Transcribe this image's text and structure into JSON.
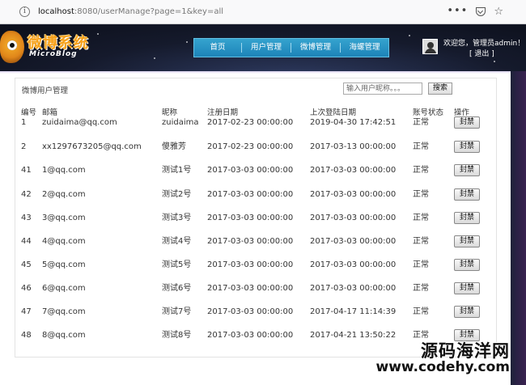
{
  "browser": {
    "url_host": "localhost",
    "url_rest": ":8080/userManage?page=1&key=all",
    "menu_dots": "•••"
  },
  "header": {
    "logo_text": "微博系统",
    "logo_sub": "MicroBlog",
    "nav": [
      "首页",
      "用户管理",
      "微博管理",
      "海螺管理"
    ],
    "welcome": "欢迎您，管理员admin！",
    "logout": "[ 退出 ]"
  },
  "panel": {
    "title": "微博用户管理",
    "search_placeholder": "输入用户昵称。。。",
    "search_button": "搜索"
  },
  "table": {
    "headers": [
      "编号",
      "邮箱",
      "昵称",
      "注册日期",
      "上次登陆日期",
      "账号状态",
      "操作"
    ],
    "rows": [
      {
        "id": "1",
        "email": "zuidaima@qq.com",
        "nick": "zuidaima",
        "reg": "2017-02-23 00:00:00",
        "last": "2019-04-30 17:42:51",
        "status": "正常",
        "action": "封禁"
      },
      {
        "id": "2",
        "email": "xx1297673205@qq.com",
        "nick": "傻雅芳",
        "reg": "2017-02-23 00:00:00",
        "last": "2017-03-13 00:00:00",
        "status": "正常",
        "action": "封禁"
      },
      {
        "id": "41",
        "email": "1@qq.com",
        "nick": "测试1号",
        "reg": "2017-03-03 00:00:00",
        "last": "2017-03-03 00:00:00",
        "status": "正常",
        "action": "封禁"
      },
      {
        "id": "42",
        "email": "2@qq.com",
        "nick": "测试2号",
        "reg": "2017-03-03 00:00:00",
        "last": "2017-03-03 00:00:00",
        "status": "正常",
        "action": "封禁"
      },
      {
        "id": "43",
        "email": "3@qq.com",
        "nick": "测试3号",
        "reg": "2017-03-03 00:00:00",
        "last": "2017-03-03 00:00:00",
        "status": "正常",
        "action": "封禁"
      },
      {
        "id": "44",
        "email": "4@qq.com",
        "nick": "测试4号",
        "reg": "2017-03-03 00:00:00",
        "last": "2017-03-03 00:00:00",
        "status": "正常",
        "action": "封禁"
      },
      {
        "id": "45",
        "email": "5@qq.com",
        "nick": "测试5号",
        "reg": "2017-03-03 00:00:00",
        "last": "2017-03-03 00:00:00",
        "status": "正常",
        "action": "封禁"
      },
      {
        "id": "46",
        "email": "6@qq.com",
        "nick": "测试6号",
        "reg": "2017-03-03 00:00:00",
        "last": "2017-03-03 00:00:00",
        "status": "正常",
        "action": "封禁"
      },
      {
        "id": "47",
        "email": "7@qq.com",
        "nick": "测试7号",
        "reg": "2017-03-03 00:00:00",
        "last": "2017-04-17 11:14:39",
        "status": "正常",
        "action": "封禁"
      },
      {
        "id": "48",
        "email": "8@qq.com",
        "nick": "测试8号",
        "reg": "2017-03-03 00:00:00",
        "last": "2017-04-21 13:50:22",
        "status": "正常",
        "action": "封禁"
      }
    ]
  },
  "watermark": {
    "line1": "源码海洋网",
    "line2": "www.codehy.com"
  },
  "colors": {
    "nav_bg": "#2a96c6",
    "header_bg": "#151a2c",
    "logo_orange": "#f7a11a"
  }
}
